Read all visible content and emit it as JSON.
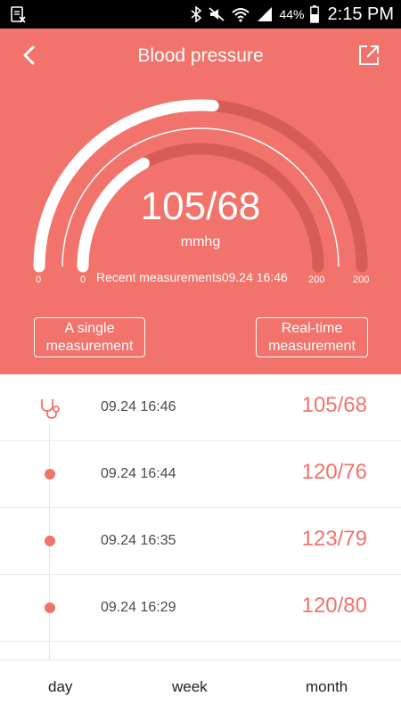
{
  "status_bar": {
    "battery_percent": "44%",
    "time": "2:15 PM"
  },
  "header": {
    "title": "Blood pressure"
  },
  "gauge": {
    "reading": "105/68",
    "unit": "mmhg",
    "recent_label": "Recent measurements09.24 16:46",
    "outer_min": "0",
    "inner_min": "0",
    "inner_max": "200",
    "outer_max": "200",
    "systolic_fraction": 0.525,
    "diastolic_fraction": 0.34
  },
  "buttons": {
    "single_line1": "A single",
    "single_line2": "measurement",
    "realtime_line1": "Real-time",
    "realtime_line2": "measurement"
  },
  "measurements": [
    {
      "time": "09.24 16:46",
      "value": "105/68"
    },
    {
      "time": "09.24 16:44",
      "value": "120/76"
    },
    {
      "time": "09.24 16:35",
      "value": "123/79"
    },
    {
      "time": "09.24 16:29",
      "value": "120/80"
    }
  ],
  "tabs": {
    "day": "day",
    "week": "week",
    "month": "month"
  },
  "colors": {
    "accent": "#f1736b",
    "track": "#d65c58"
  }
}
